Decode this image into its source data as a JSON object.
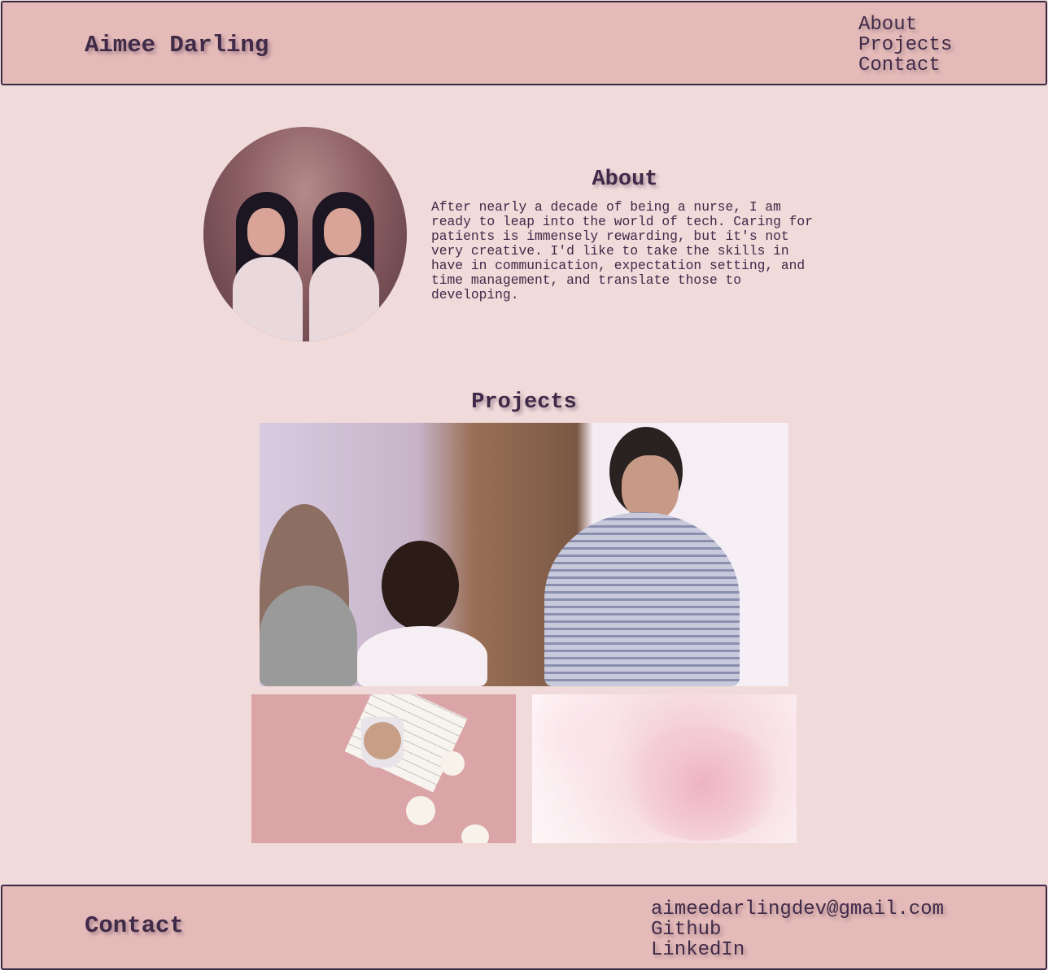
{
  "header": {
    "site_title": "Aimee Darling",
    "nav": [
      "About",
      "Projects",
      "Contact"
    ]
  },
  "about": {
    "heading": "About",
    "text": "After nearly a decade of being a nurse, I am ready to leap into the world of tech. Caring for patients is immensely rewarding, but it's not very creative. I'd like to take the skills in have in communication, expectation setting, and time management, and translate those to developing."
  },
  "projects": {
    "heading": "Projects"
  },
  "footer": {
    "title": "Contact",
    "links": [
      "aimeedarlingdev@gmail.com",
      "Github",
      "LinkedIn"
    ]
  },
  "colors": {
    "background": "#f0dada",
    "header_bg": "#e5bbb9",
    "text": "#3f2a48",
    "border": "#3a2a46"
  }
}
